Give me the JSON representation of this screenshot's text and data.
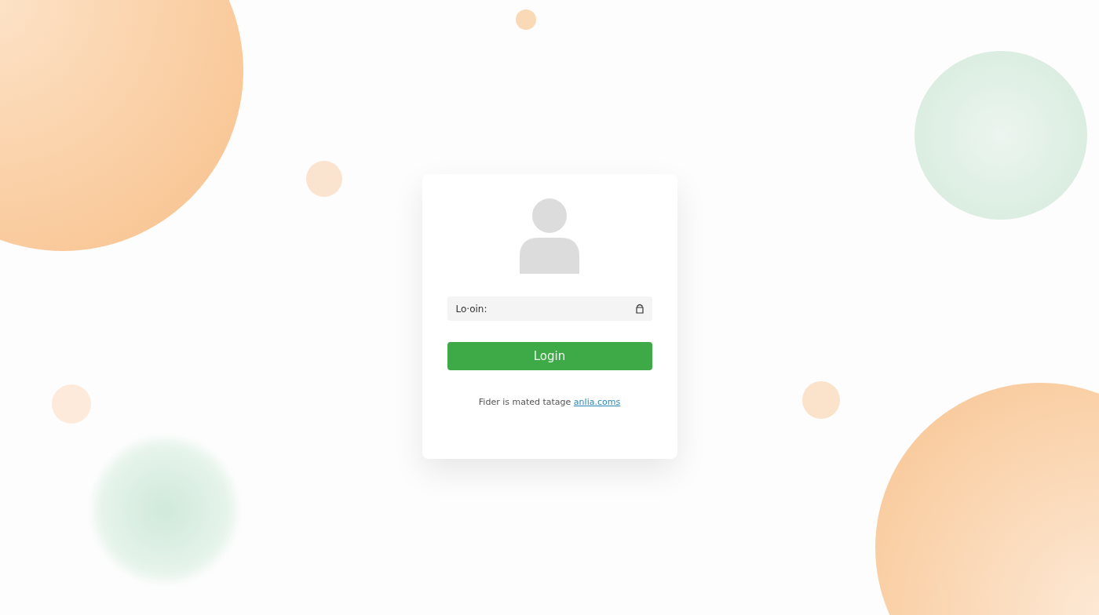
{
  "login_card": {
    "username_field": {
      "value": "Lo·oin:"
    },
    "login_button": {
      "label": "Login"
    },
    "footer": {
      "text": "Fider is mated tatage",
      "link": "anlia.coms"
    }
  }
}
